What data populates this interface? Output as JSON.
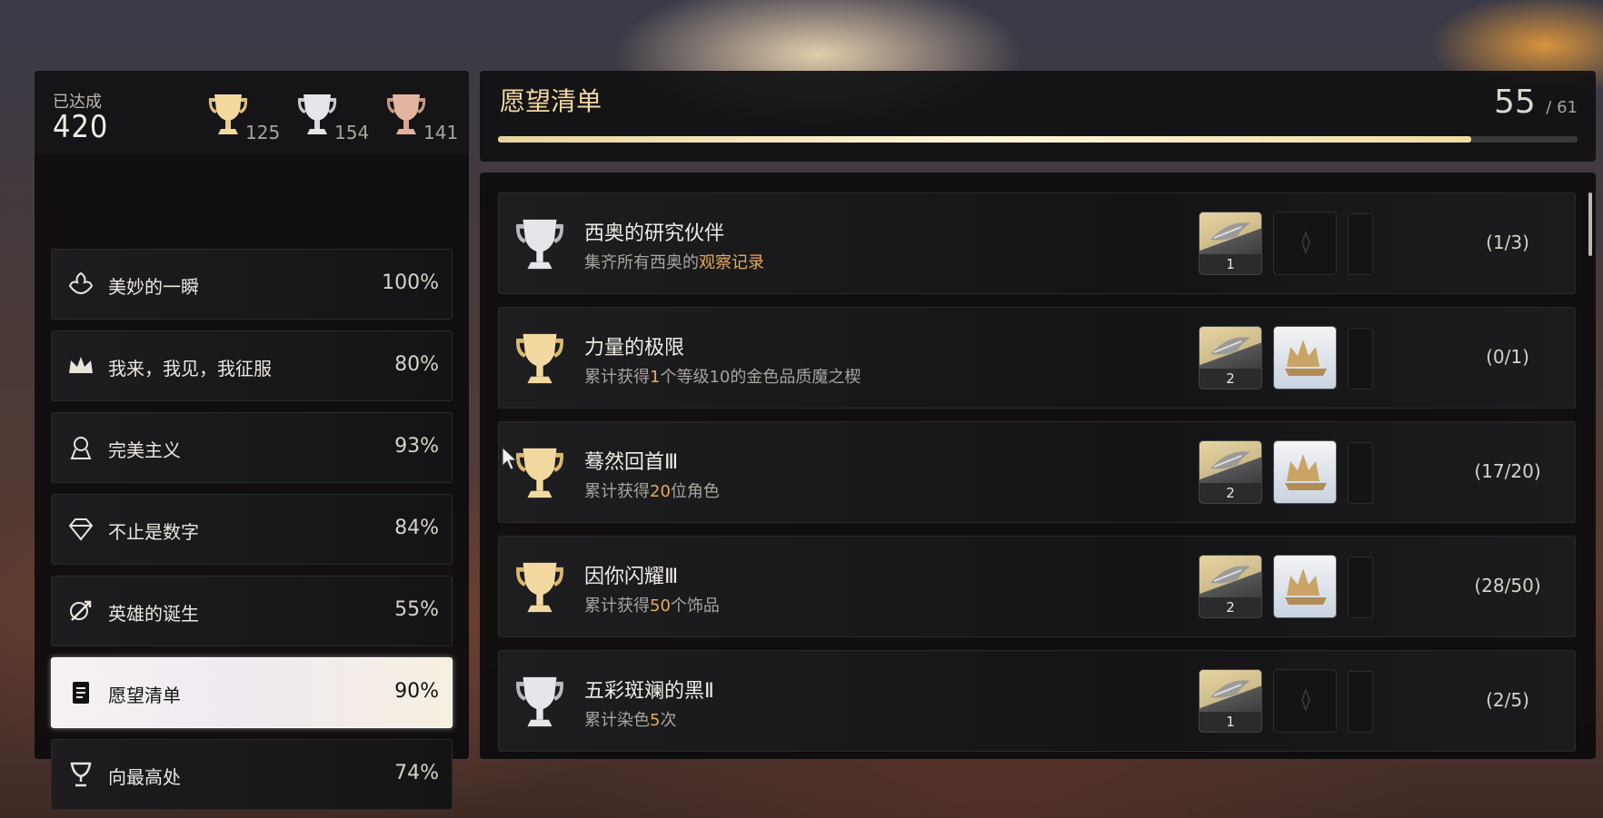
{
  "summary": {
    "achieved_label": "已达成",
    "achieved_count": "420",
    "gold_count": "125",
    "silver_count": "154",
    "bronze_count": "141"
  },
  "categories": [
    {
      "label": "美妙的一瞬",
      "percent": "100%",
      "icon": "rose-icon",
      "active": false
    },
    {
      "label": "我来，我见，我征服",
      "percent": "80%",
      "icon": "crown-icon",
      "active": false
    },
    {
      "label": "完美主义",
      "percent": "93%",
      "icon": "medal-icon",
      "active": false
    },
    {
      "label": "不止是数字",
      "percent": "84%",
      "icon": "diamond-icon",
      "active": false
    },
    {
      "label": "英雄的诞生",
      "percent": "55%",
      "icon": "sword-icon",
      "active": false
    },
    {
      "label": "愿望清单",
      "percent": "90%",
      "icon": "notebook-icon",
      "active": true
    },
    {
      "label": "向最高处",
      "percent": "74%",
      "icon": "chalice-icon",
      "active": false
    }
  ],
  "wishlist": {
    "title": "愿望清单",
    "completed": "55",
    "total": "/ 61",
    "progress": 0.9016
  },
  "achievements": [
    {
      "name": "西奥的研究伙伴",
      "desc_pre": "集齐所有西奥的",
      "desc_hl": "观察记录",
      "desc_post": "",
      "trophy": "silver",
      "reward_qty": "1",
      "second_reward": false,
      "progress": "(1/3)"
    },
    {
      "name": "力量的极限",
      "desc_pre": "累计获得",
      "desc_hl": "1",
      "desc_post": "个等级10的金色品质魔之楔",
      "trophy": "gold",
      "reward_qty": "2",
      "second_reward": true,
      "progress": "(0/1)"
    },
    {
      "name": "蓦然回首Ⅲ",
      "desc_pre": "累计获得",
      "desc_hl": "20",
      "desc_post": "位角色",
      "trophy": "gold",
      "reward_qty": "2",
      "second_reward": true,
      "progress": "(17/20)"
    },
    {
      "name": "因你闪耀Ⅲ",
      "desc_pre": "累计获得",
      "desc_hl": "50",
      "desc_post": "个饰品",
      "trophy": "gold",
      "reward_qty": "2",
      "second_reward": true,
      "progress": "(28/50)"
    },
    {
      "name": "五彩斑斓的黑Ⅱ",
      "desc_pre": "累计染色",
      "desc_hl": "5",
      "desc_post": "次",
      "trophy": "silver",
      "reward_qty": "1",
      "second_reward": false,
      "progress": "(2/5)"
    }
  ],
  "colors": {
    "gold": "#f3d9a0",
    "silver": "#e6e6ea",
    "bronze": "#e2b5a0",
    "highlight": "#e7a95a"
  }
}
